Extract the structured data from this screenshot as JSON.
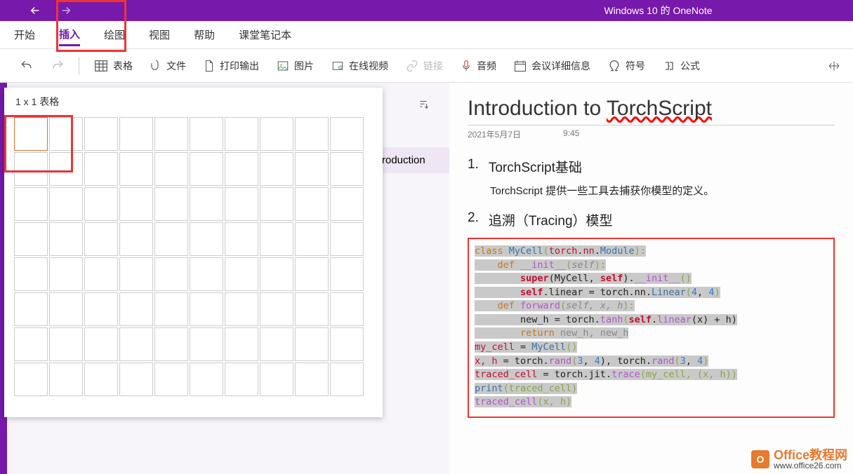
{
  "title": "Windows 10 的 OneNote",
  "menu": {
    "items": [
      "开始",
      "插入",
      "绘图",
      "视图",
      "帮助",
      "课堂笔记本"
    ],
    "active": 1
  },
  "toolbar": {
    "undo": "",
    "redo": "",
    "table": "表格",
    "file": "文件",
    "print": "打印输出",
    "image": "图片",
    "video": "在线视频",
    "link": "链接",
    "audio": "音频",
    "meeting": "会议详细信息",
    "symbol": "符号",
    "formula": "公式"
  },
  "table_popup": {
    "label": "1 x 1 表格",
    "rows": 8,
    "cols": 10,
    "sel_row": 1,
    "sel_col": 1
  },
  "sidebar_note": "roduction",
  "page": {
    "title_parts": [
      "Introduction to ",
      "TorchScript"
    ],
    "date": "2021年5月7日",
    "time": "9:45",
    "h1_num": "1.",
    "h1": "TorchScript基础",
    "h1_body": "TorchScript 提供一些工具去捕获你模型的定义。",
    "h2_num": "2.",
    "h2": "追溯（Tracing）模型"
  },
  "code": {
    "l1": {
      "a": "class ",
      "b": "MyCell",
      "c": "(",
      "d": "torch",
      "e": ".",
      "f": "nn",
      "g": ".",
      "h": "Module",
      "i": "):"
    },
    "l2": {
      "a": "    def ",
      "b": "__init__",
      "c": "(",
      "d": "self",
      "e": "):"
    },
    "l3": {
      "a": "        super",
      "b": "(MyCell, ",
      "c": "self",
      "d": ").",
      "e": "__init__",
      "f": "()"
    },
    "l4": {
      "a": "        ",
      "b": "self",
      "c": ".linear = torch.nn.",
      "d": "Linear",
      "e": "(",
      "f": "4",
      "g": ", ",
      "h": "4",
      "i": ")"
    },
    "l5": {
      "a": "    def ",
      "b": "forward",
      "c": "(",
      "d": "self, x, h",
      "e": "):"
    },
    "l6": {
      "a": "        new_h = torch.",
      "b": "tanh",
      "c": "(",
      "d": "self",
      "e": ".",
      "f": "linear",
      "g": "(x) + h)"
    },
    "l7": {
      "a": "        return ",
      "b": "new_h, new_h"
    },
    "l8": {
      "a": "my_cell",
      "b": " = ",
      "c": "MyCell",
      "d": "()"
    },
    "l9": {
      "a": "x, h",
      "b": " = torch.",
      "c": "rand",
      "d": "(",
      "e": "3",
      "f": ", ",
      "g": "4",
      "h": "), torch.",
      "i": "rand",
      "j": "(",
      "k": "3",
      "l": ", ",
      "m": "4",
      "n": ")"
    },
    "l10": {
      "a": "traced_cell",
      "b": " = torch.jit.",
      "c": "trace",
      "d": "(my_cell, (x, h))"
    },
    "l11": {
      "a": "print",
      "b": "(traced_cell)"
    },
    "l12": {
      "a": "traced_cell",
      "b": "(x, h)"
    }
  },
  "watermark": {
    "badge": "O",
    "name": "Office教程网",
    "url": "www.office26.com"
  }
}
